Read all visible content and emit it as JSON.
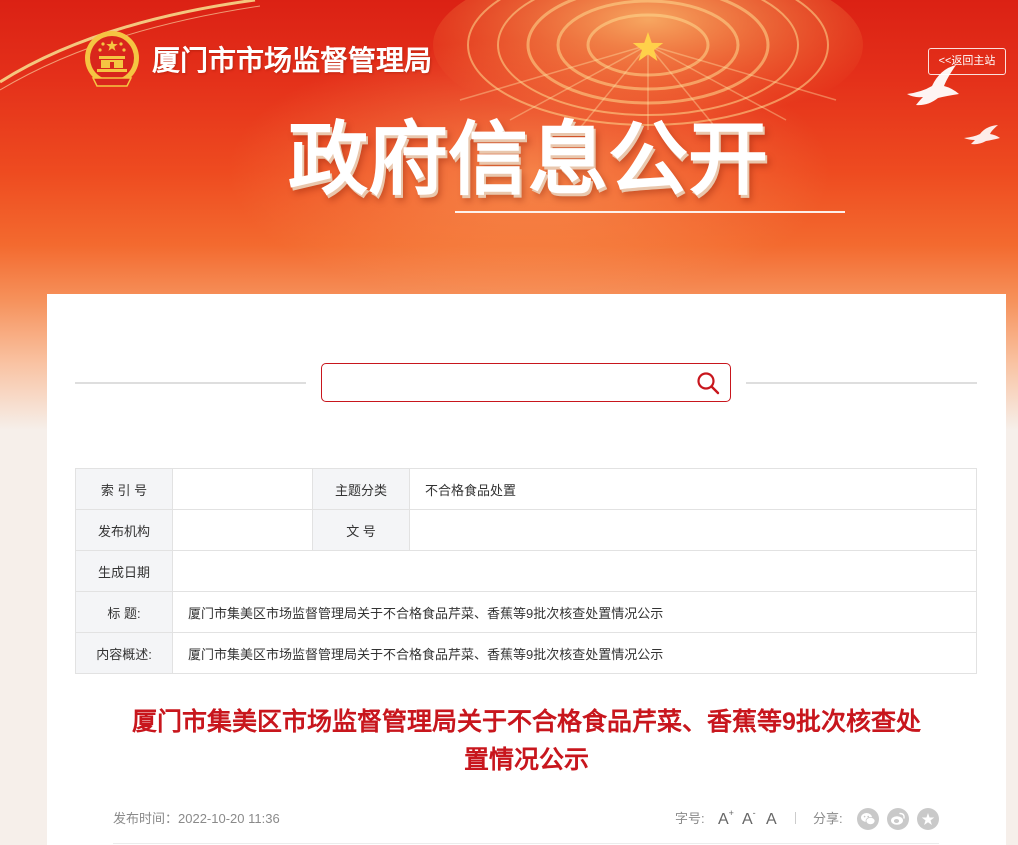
{
  "header": {
    "site_title": "厦门市市场监督管理局",
    "back_link": "<<返回主站",
    "banner_title": "政府信息公开"
  },
  "search": {
    "value": "",
    "placeholder": ""
  },
  "info_table": {
    "index_label": "索 引 号",
    "index_value": "",
    "category_label": "主题分类",
    "category_value": "不合格食品处置",
    "publisher_label": "发布机构",
    "publisher_value": "",
    "doc_no_label": "文 号",
    "doc_no_value": "",
    "date_label": "生成日期",
    "date_value": "",
    "title_label": "标 题:",
    "title_value": "厦门市集美区市场监督管理局关于不合格食品芹菜、香蕉等9批次核查处置情况公示",
    "summary_label": "内容概述:",
    "summary_value": "厦门市集美区市场监督管理局关于不合格食品芹菜、香蕉等9批次核查处置情况公示"
  },
  "article": {
    "title": "厦门市集美区市场监督管理局关于不合格食品芹菜、香蕉等9批次核查处置情况公示",
    "publish_label": "发布时间：",
    "publish_time": "2022-10-20 11:36",
    "font_size_label": "字号:",
    "font_size_options": [
      {
        "text": "A",
        "mark": "+"
      },
      {
        "text": "A",
        "mark": "-"
      },
      {
        "text": "A",
        "mark": ""
      }
    ],
    "share_label": "分享:"
  },
  "icons": {
    "emblem": "national-emblem-icon",
    "search": "search-icon",
    "dove": "dove-icon",
    "share": [
      "wechat-icon",
      "weibo-icon",
      "favorite-icon"
    ]
  },
  "colors": {
    "accent": "#c8161d",
    "header_red": "#db2114",
    "label_bg": "#f4f5f7",
    "border": "#e2e2e2"
  }
}
